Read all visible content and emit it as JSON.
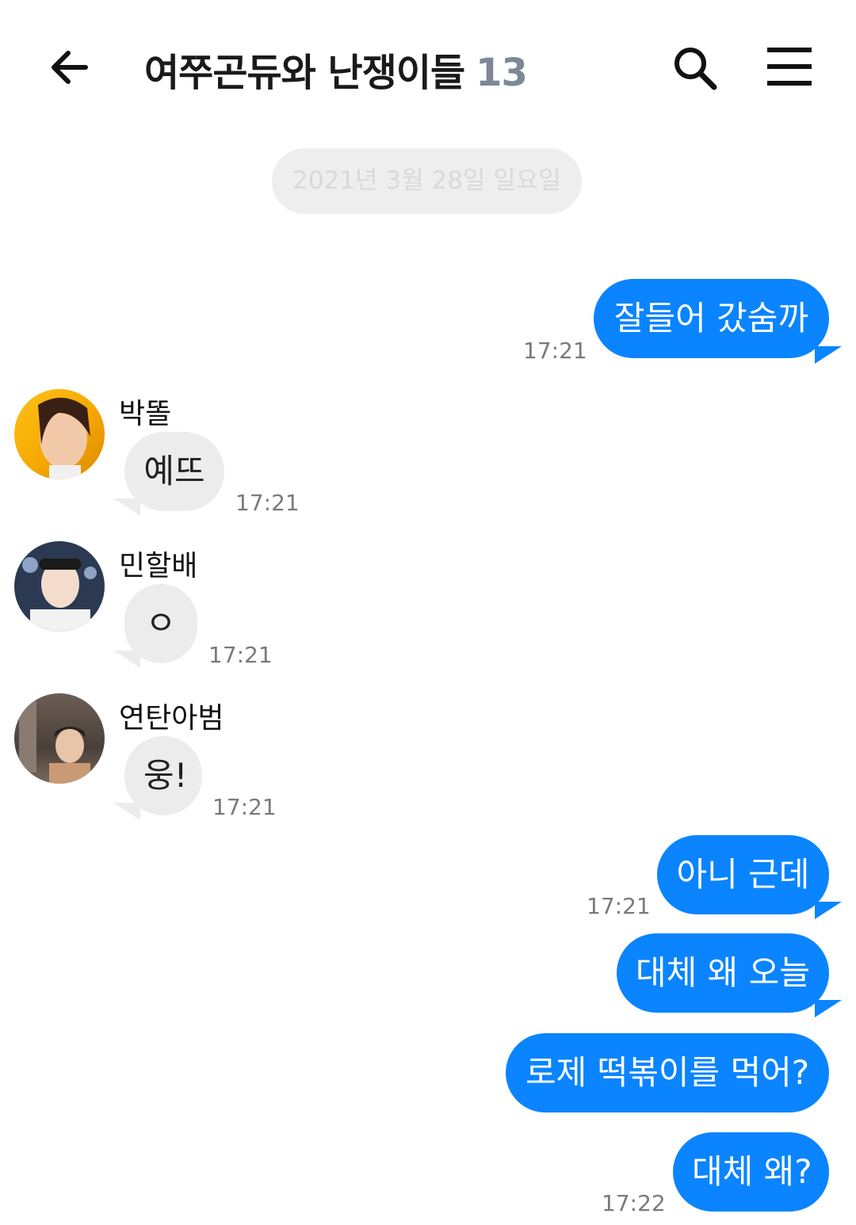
{
  "header": {
    "title": "여쭈곤듀와 난쟁이들",
    "member_count": "13",
    "icons": {
      "back": "arrow-left-icon",
      "search": "search-icon",
      "menu": "hamburger-menu-icon"
    }
  },
  "date_divider": "2021년 3월 28일 일요일",
  "colors": {
    "outgoing": "#0a84ff",
    "incoming": "#ececec",
    "date_text": "#d9d9d9",
    "count": "#7d8894"
  },
  "messages": [
    {
      "direction": "out",
      "text": "잘들어 갔숨까",
      "time": "17:21"
    },
    {
      "direction": "in",
      "sender": "박똘",
      "text": "예뜨",
      "time": "17:21"
    },
    {
      "direction": "in",
      "sender": "민할배",
      "text": "ㅇ",
      "time": "17:21"
    },
    {
      "direction": "in",
      "sender": "연탄아범",
      "text": "웅!",
      "time": "17:21"
    },
    {
      "direction": "out",
      "text": "아니 근데",
      "time": "17:21"
    },
    {
      "direction": "out",
      "text": "대체 왜 오늘",
      "time": ""
    },
    {
      "direction": "out",
      "text": "로제 떡볶이를 먹어?",
      "time": ""
    },
    {
      "direction": "out",
      "text": "대체 왜?",
      "time": "17:22"
    }
  ]
}
